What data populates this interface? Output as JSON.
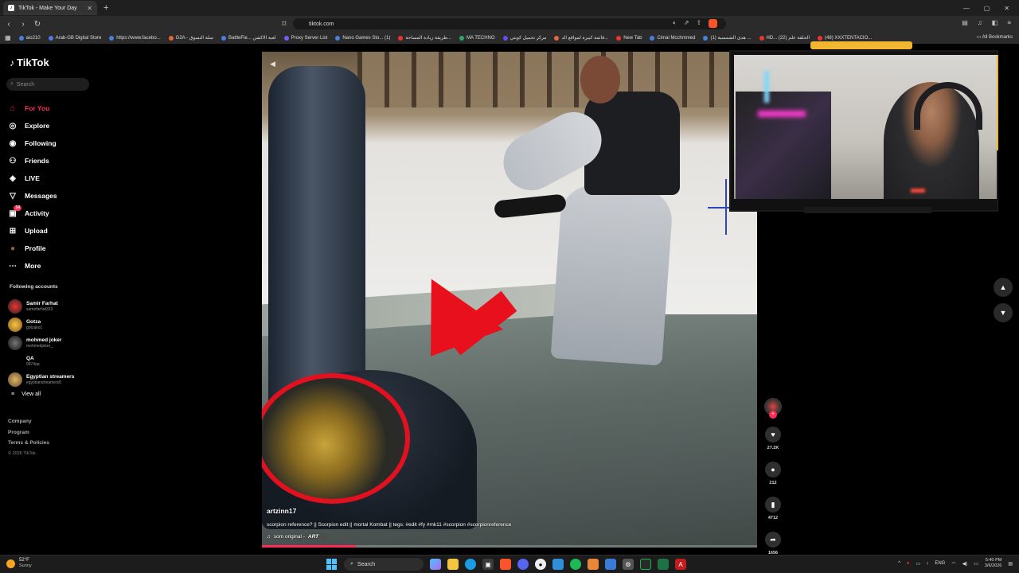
{
  "browser": {
    "tab_title": "TikTok - Make Your Day",
    "new_tab": "+",
    "url": "tiktok.com",
    "bookmarks": [
      "aio210",
      "Arab-GB Digital Store",
      "https://www.facebo...",
      "G2A - سلة التسوق",
      "BattleFie... لعبة الاكشن",
      "Proxy Server List",
      "Nano Games Sto... (1)",
      "طريقة زيادة المساحة...",
      "MA TECHNO",
      "مركز تحميل كوبتي",
      "قائمة كبيرة لمواقع الد...",
      "New Tab",
      "Cimal Mcchmmed",
      "(1) هدى الشمسية ...",
      "HD... الحلقة علم (22)",
      "(48) XXXTENTACIO..."
    ],
    "all_bookmarks": "All Bookmarks"
  },
  "sidebar": {
    "logo": "TikTok",
    "search_placeholder": "Search",
    "menu": [
      {
        "label": "For You",
        "icon": "home-icon",
        "glyph": "⌂"
      },
      {
        "label": "Explore",
        "icon": "compass-icon",
        "glyph": "◎"
      },
      {
        "label": "Following",
        "icon": "following-icon",
        "glyph": "◉"
      },
      {
        "label": "Friends",
        "icon": "friends-icon",
        "glyph": "⚇"
      },
      {
        "label": "LIVE",
        "icon": "live-icon",
        "glyph": "◈"
      },
      {
        "label": "Messages",
        "icon": "messages-icon",
        "glyph": "▽"
      },
      {
        "label": "Activity",
        "icon": "activity-icon",
        "glyph": "▣",
        "badge": "14"
      },
      {
        "label": "Upload",
        "icon": "upload-icon",
        "glyph": "⊞"
      },
      {
        "label": "Profile",
        "icon": "profile-icon",
        "glyph": "●"
      },
      {
        "label": "More",
        "icon": "more-icon",
        "glyph": "⋯"
      }
    ],
    "following_title": "Following accounts",
    "accounts": [
      {
        "name": "Samir Farhat",
        "handle": "samirfarhat333"
      },
      {
        "name": "Gotza",
        "handle": "gotzako1"
      },
      {
        "name": "mohmed joker",
        "handle": "mohmedjoker_"
      },
      {
        "name": "QA",
        "handle": "9974qa"
      },
      {
        "name": "Egyptian streamers",
        "handle": "egyptianstreamers0"
      }
    ],
    "view_all": "View all",
    "footer": [
      "Company",
      "Program",
      "Terms & Policies"
    ],
    "copyright": "© 2026 TikTok"
  },
  "video": {
    "username": "artzinn17",
    "caption": "scorpion reference? || Scorpion edit || mortal Kombat || tegs: #edit #fy #mk11 #scorpion #scorpionreference",
    "music_prefix": "som original -",
    "music_author": "ART",
    "progress": 0.19
  },
  "actions": {
    "likes": "27.2K",
    "comments": "212",
    "saves": "4712",
    "shares": "1656"
  },
  "taskbar": {
    "temp": "52°F",
    "weather": "Sunny",
    "search": "Search",
    "lang": "ENG",
    "time": "5:40 PM",
    "date": "3/6/2026"
  },
  "colors": {
    "accent": "#fe2c55",
    "background": "#000000"
  }
}
